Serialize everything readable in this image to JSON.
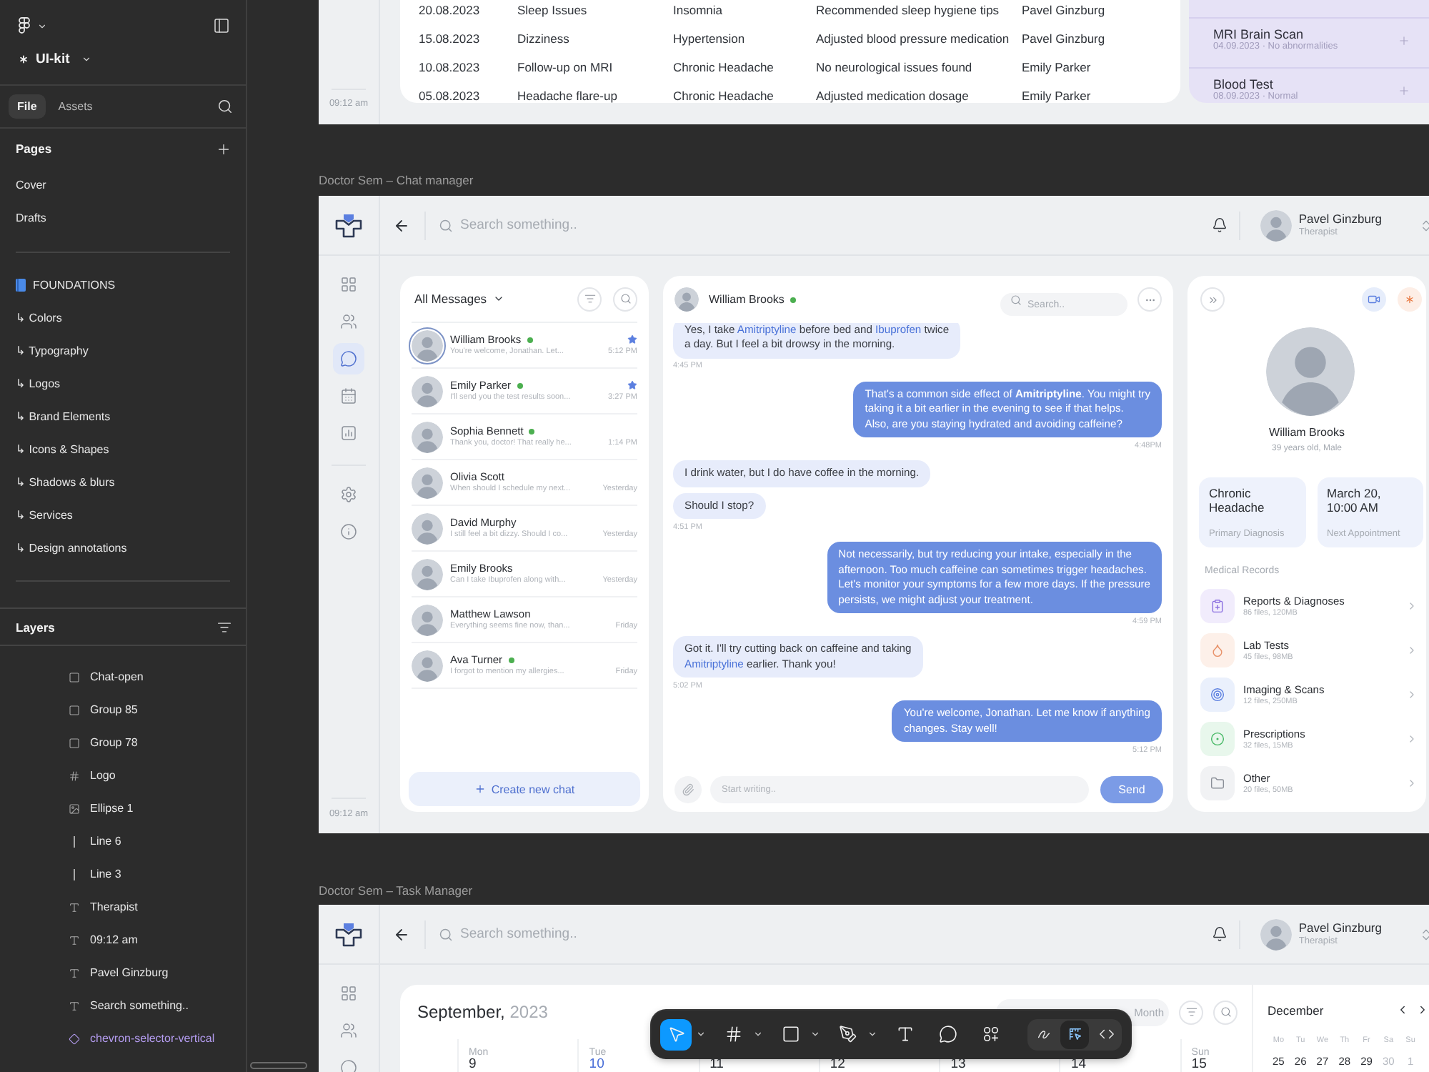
{
  "figma_panel": {
    "file_name": "UI-kit",
    "tabs": [
      {
        "label": "File",
        "selected": true
      },
      {
        "label": "Assets",
        "selected": false
      }
    ],
    "pages_title": "Pages",
    "pages": [
      {
        "label": "Cover",
        "kind": "page"
      },
      {
        "label": "Drafts",
        "kind": "page"
      },
      {
        "label": "FOUNDATIONS",
        "kind": "section"
      },
      {
        "label": "↳ Colors",
        "kind": "page"
      },
      {
        "label": "↳ Typography",
        "kind": "page"
      },
      {
        "label": "↳ Logos",
        "kind": "page"
      },
      {
        "label": "↳ Brand Elements",
        "kind": "page"
      },
      {
        "label": "↳ Icons & Shapes",
        "kind": "page"
      },
      {
        "label": "↳ Shadows & blurs",
        "kind": "page"
      },
      {
        "label": "↳ Services",
        "kind": "page"
      },
      {
        "label": "↳ Design annotations",
        "kind": "page"
      }
    ],
    "layers_title": "Layers",
    "layers": [
      {
        "label": "Chat-open",
        "kind": "group"
      },
      {
        "label": "Group 85",
        "kind": "group"
      },
      {
        "label": "Group 78",
        "kind": "group"
      },
      {
        "label": "Logo",
        "kind": "grid"
      },
      {
        "label": "Ellipse 1",
        "kind": "image"
      },
      {
        "label": "Line 6",
        "kind": "line"
      },
      {
        "label": "Line 3",
        "kind": "line"
      },
      {
        "label": "Therapist",
        "kind": "text"
      },
      {
        "label": "09:12 am",
        "kind": "text"
      },
      {
        "label": "Pavel Ginzburg",
        "kind": "text"
      },
      {
        "label": "Search something..",
        "kind": "text"
      },
      {
        "label": "chevron-selector-vertical",
        "kind": "component"
      }
    ]
  },
  "top_frame": {
    "time": "09:12 am",
    "table": {
      "rows": [
        {
          "cells": [
            "20.08.2023",
            "Sleep Issues",
            "Insomnia",
            "Recommended sleep hygiene tips",
            "Pavel Ginzburg"
          ]
        },
        {
          "cells": [
            "15.08.2023",
            "Dizziness",
            "Hypertension",
            "Adjusted blood pressure medication",
            "Pavel Ginzburg"
          ]
        },
        {
          "cells": [
            "10.08.2023",
            "Follow-up on MRI",
            "Chronic Headache",
            "No neurological issues found",
            "Emily Parker"
          ]
        },
        {
          "cells": [
            "05.08.2023",
            "Headache flare-up",
            "Chronic Headache",
            "Adjusted medication dosage",
            "Emily Parker"
          ]
        }
      ]
    },
    "side_card": {
      "items": [
        {
          "title": "MRI Brain Scan",
          "subtitle": "04.09.2023 · No abnormalities"
        },
        {
          "title": "Blood Test",
          "subtitle": "08.09.2023 · Normal"
        }
      ]
    }
  },
  "chat_frame": {
    "label": "Doctor Sem – Chat manager",
    "header": {
      "search_placeholder": "Search something..",
      "user": {
        "name": "Pavel Ginzburg",
        "role": "Therapist"
      }
    },
    "nav": {
      "main": [
        {
          "kind": "dashboard",
          "selected": false
        },
        {
          "kind": "patients",
          "selected": false
        },
        {
          "kind": "chat",
          "selected": true
        },
        {
          "kind": "calendar",
          "selected": false
        },
        {
          "kind": "reports",
          "selected": false
        }
      ],
      "extra": [
        {
          "kind": "settings",
          "selected": false
        },
        {
          "kind": "info",
          "selected": false
        }
      ]
    },
    "time": "09:12 am",
    "chat_list": {
      "title": "All Messages",
      "items": [
        {
          "name": "William Brooks",
          "preview": "You're welcome, Jonathan. Let...",
          "time": "5:12 PM",
          "online": true,
          "starred": true,
          "selected": true
        },
        {
          "name": "Emily Parker",
          "preview": "I'll send you the test results soon...",
          "time": "3:27 PM",
          "online": true,
          "starred": true,
          "selected": false
        },
        {
          "name": "Sophia Bennett",
          "preview": "Thank you, doctor! That really he...",
          "time": "1:14 PM",
          "online": true,
          "starred": false,
          "selected": false
        },
        {
          "name": "Olivia Scott",
          "preview": "When should I schedule my next...",
          "time": "Yesterday",
          "online": false,
          "starred": false,
          "selected": false
        },
        {
          "name": "David Murphy",
          "preview": "I still feel a bit dizzy. Should I co...",
          "time": "Yesterday",
          "online": false,
          "starred": false,
          "selected": false
        },
        {
          "name": "Emily Brooks",
          "preview": "Can I take Ibuprofen along with...",
          "time": "Yesterday",
          "online": false,
          "starred": false,
          "selected": false
        },
        {
          "name": "Matthew Lawson",
          "preview": "Everything seems fine now, than...",
          "time": "Friday",
          "online": false,
          "starred": false,
          "selected": false
        },
        {
          "name": "Ava Turner",
          "preview": "I forgot to mention my allergies...",
          "time": "Friday",
          "online": true,
          "starred": false,
          "selected": false
        }
      ],
      "create_label": "Create new chat"
    },
    "conversation": {
      "contact": {
        "name": "William Brooks",
        "online": true
      },
      "search_placeholder": "Search..",
      "groups": [
        {
          "kind": "incoming",
          "messages": [
            "Yes, I take **Amitriptyline** before bed and **Ibuprofen** twice\na day. But I feel a bit drowsy in the morning."
          ],
          "time": "4:45 PM"
        },
        {
          "kind": "outgoing",
          "messages": [
            "That's a common side effect of **Amitriptyline**. You might try\ntaking it a bit earlier in the evening to see if that helps.\nAlso, are you staying hydrated and avoiding caffeine?"
          ],
          "time": "4:48PM"
        },
        {
          "kind": "incoming",
          "messages": [
            "I drink water, but I do have coffee in the morning.",
            "Should I stop?"
          ],
          "time": "4:51 PM"
        },
        {
          "kind": "outgoing",
          "messages": [
            "Not necessarily, but try reducing your intake, especially in the\nafternoon. Too much caffeine can sometimes trigger headaches.\nLet's monitor your symptoms for a few more days. If the pressure\npersists, we might adjust your treatment."
          ],
          "time": "4:59 PM"
        },
        {
          "kind": "incoming",
          "messages": [
            "Got it. I'll try cutting back on caffeine and taking\n**Amitriptyline** earlier. Thank you!"
          ],
          "time": "5:02 PM"
        },
        {
          "kind": "outgoing",
          "messages": [
            "You're welcome, Jonathan. Let me know if anything\nchanges. Stay well!"
          ],
          "time": "5:12 PM"
        }
      ],
      "input_placeholder": "Start writing..",
      "send_label": "Send"
    },
    "profile": {
      "name": "William Brooks",
      "details": "39 years old, Male",
      "facts": [
        {
          "value": "Chronic Headache",
          "label": "Primary Diagnosis"
        },
        {
          "value": "March 20, 10:00 AM",
          "label": "Next Appointment"
        }
      ],
      "records_title": "Medical Records",
      "records": [
        {
          "kind": "reports",
          "title": "Reports & Diagnoses",
          "meta": "86 files, 120MB"
        },
        {
          "kind": "lab",
          "title": "Lab Tests",
          "meta": "45 files, 98MB"
        },
        {
          "kind": "imaging",
          "title": "Imaging & Scans",
          "meta": "12 files, 250MB"
        },
        {
          "kind": "prescriptions",
          "title": "Prescriptions",
          "meta": "32 files, 15MB"
        },
        {
          "kind": "other",
          "title": "Other",
          "meta": "20 files, 50MB"
        }
      ]
    }
  },
  "task_frame": {
    "label": "Doctor Sem – Task Manager",
    "header": {
      "search_placeholder": "Search something..",
      "user": {
        "name": "Pavel Ginzburg",
        "role": "Therapist"
      }
    },
    "nav": {
      "main": [
        {
          "kind": "dashboard",
          "selected": false
        },
        {
          "kind": "patients",
          "selected": false
        },
        {
          "kind": "chat",
          "selected": false
        }
      ]
    },
    "calendar": {
      "month": "September,",
      "year": "2023",
      "views": [
        {
          "label": "Month",
          "selected": false
        }
      ],
      "days": [
        {
          "name": "Mon",
          "number": "9",
          "selected": false
        },
        {
          "name": "Tue",
          "number": "10",
          "selected": true
        },
        {
          "number": "11",
          "selected": false
        },
        {
          "number": "12",
          "selected": false
        },
        {
          "number": "13",
          "selected": false
        },
        {
          "number": "14",
          "selected": false
        },
        {
          "name": "Sun",
          "number": "15",
          "selected": false
        }
      ]
    },
    "mini_calendar": {
      "month": "December",
      "weekdays": [
        "Mo",
        "Tu",
        "We",
        "Th",
        "Fr",
        "Sa",
        "Su"
      ],
      "dates": [
        {
          "label": "25",
          "muted": false
        },
        {
          "label": "26",
          "muted": false
        },
        {
          "label": "27",
          "muted": false
        },
        {
          "label": "28",
          "muted": false
        },
        {
          "label": "29",
          "muted": false
        },
        {
          "label": "30",
          "muted": true
        },
        {
          "label": "1",
          "muted": true
        }
      ]
    }
  },
  "toolbar": {
    "tools": [
      {
        "kind": "move",
        "selected": true,
        "menu": true
      },
      {
        "kind": "frame",
        "selected": false,
        "menu": true
      },
      {
        "kind": "shape",
        "selected": false,
        "menu": true
      },
      {
        "kind": "pen",
        "selected": false,
        "menu": true
      },
      {
        "kind": "text",
        "selected": false,
        "menu": false
      },
      {
        "kind": "comment",
        "selected": false,
        "menu": false
      },
      {
        "kind": "actions",
        "selected": false,
        "menu": false
      }
    ],
    "modes": [
      {
        "kind": "draw",
        "selected": false
      },
      {
        "kind": "dev",
        "selected": true
      },
      {
        "kind": "code",
        "selected": false
      }
    ]
  }
}
